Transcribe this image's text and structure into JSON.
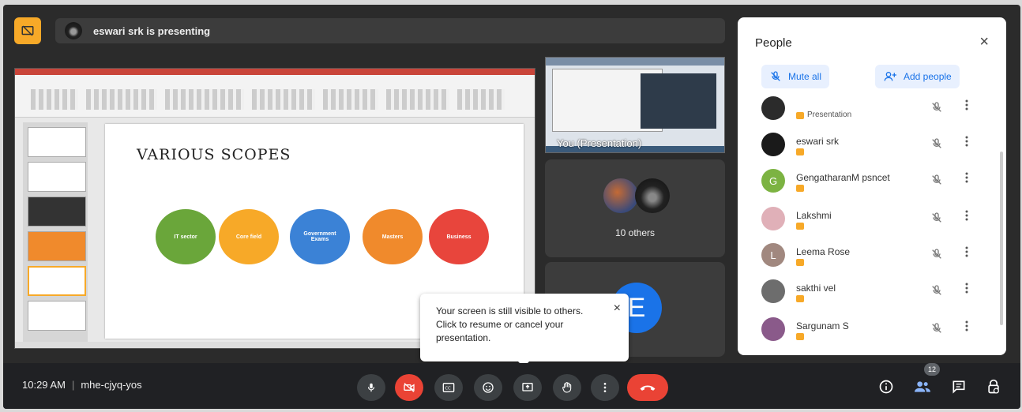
{
  "header": {
    "presenter_text": "eswari srk is presenting"
  },
  "stage": {
    "slide_title": "VARIOUS SCOPES",
    "circles": [
      {
        "label": "IT sector",
        "color": "#6aa63a"
      },
      {
        "label": "Core field",
        "color": "#f7a928"
      },
      {
        "label": "Government Exams",
        "color": "#3b82d6"
      },
      {
        "label": "Masters",
        "color": "#f08a2c"
      },
      {
        "label": "Business",
        "color": "#e8453c"
      }
    ]
  },
  "tiles": {
    "self_caption": "You (Presentation)",
    "others_label": "10 others",
    "e_initial": "E"
  },
  "tooltip": {
    "message": "Your screen is still visible to others. Click to resume or cancel your presentation.",
    "close": "×"
  },
  "people": {
    "title": "People",
    "close": "×",
    "mute_all": "Mute all",
    "add_people": "Add people",
    "participants": [
      {
        "name": "",
        "sub": "Presentation",
        "initial": "",
        "color": "#2b2b2b"
      },
      {
        "name": "eswari srk",
        "sub": "",
        "initial": "",
        "color": "#1a1a1a"
      },
      {
        "name": "GengatharanM psncet",
        "sub": "",
        "initial": "G",
        "color": "#7cb342"
      },
      {
        "name": "Lakshmi",
        "sub": "",
        "initial": "",
        "color": "#e0b0b8"
      },
      {
        "name": "Leema Rose",
        "sub": "",
        "initial": "L",
        "color": "#a1887f"
      },
      {
        "name": "sakthi vel",
        "sub": "",
        "initial": "",
        "color": "#6d6d6d"
      },
      {
        "name": "Sargunam S",
        "sub": "",
        "initial": "",
        "color": "#8a5a8a"
      }
    ]
  },
  "bottom": {
    "time": "10:29 AM",
    "separator": "|",
    "meeting_code": "mhe-cjyq-yos",
    "people_count": "12"
  },
  "colors": {
    "accent": "#1a73e8",
    "danger": "#ea4335",
    "present_badge": "#f7a928"
  }
}
